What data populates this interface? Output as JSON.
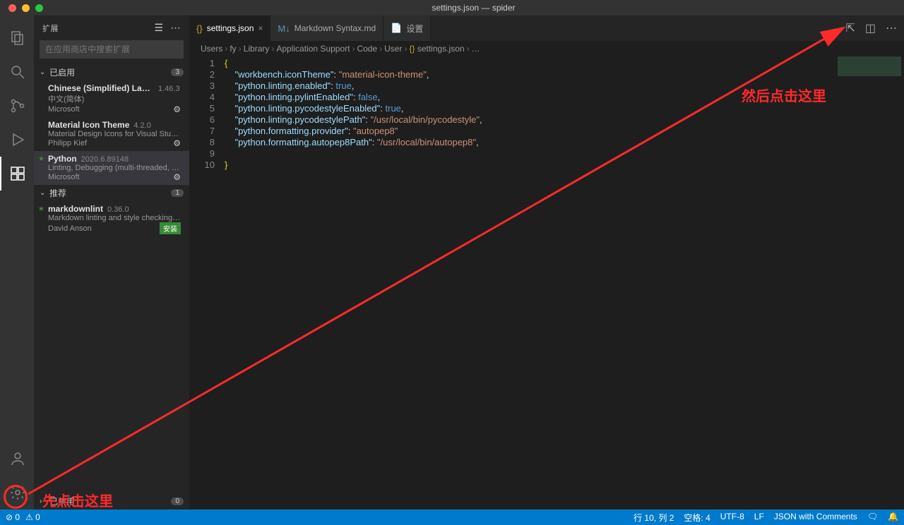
{
  "window": {
    "title": "settings.json — spider"
  },
  "sidebar": {
    "title": "扩展",
    "search_placeholder": "在应用商店中搜索扩展",
    "sections": {
      "installed": {
        "label": "已启用",
        "count": "3"
      },
      "recommended": {
        "label": "推荐",
        "count": "1"
      },
      "disabled": {
        "label": "已禁用",
        "count": "0"
      }
    },
    "installed_items": [
      {
        "name": "Chinese (Simplified) Langua…",
        "version": "1.46.3",
        "desc": "中文(简体)",
        "publisher": "Microsoft"
      },
      {
        "name": "Material Icon Theme",
        "version": "4.2.0",
        "desc": "Material Design Icons for Visual Studi…",
        "publisher": "Philipp Kief"
      },
      {
        "name": "Python",
        "version": "2020.6.89148",
        "desc": "Linting, Debugging (multi-threaded, r…",
        "publisher": "Microsoft",
        "highlighted": true,
        "starred": true
      }
    ],
    "recommended_items": [
      {
        "name": "markdownlint",
        "version": "0.36.0",
        "desc": "Markdown linting and style checking …",
        "publisher": "David Anson",
        "install": "安装",
        "starred": true
      }
    ]
  },
  "tabs": [
    {
      "id": "settings",
      "label": "settings.json",
      "active": true,
      "icon": "{}",
      "icon_color": "#c9a026"
    },
    {
      "id": "md",
      "label": "Markdown Syntax.md",
      "active": false,
      "icon": "M↓",
      "icon_color": "#519aba"
    },
    {
      "id": "settings-ui",
      "label": "设置",
      "active": false,
      "icon": "📄",
      "icon_color": "#519aba"
    }
  ],
  "breadcrumb": [
    "Users",
    "fy",
    "Library",
    "Application Support",
    "Code",
    "User",
    "settings.json",
    "…"
  ],
  "code": {
    "lines": [
      {
        "n": "1",
        "t": "{",
        "cls": "brace"
      },
      {
        "n": "2",
        "t": [
          "    ",
          [
            "\"workbench.iconTheme\"",
            "key"
          ],
          [
            ": ",
            "pun"
          ],
          [
            "\"material-icon-theme\"",
            "str"
          ],
          [
            ",",
            "pun"
          ]
        ]
      },
      {
        "n": "3",
        "t": [
          "    ",
          [
            "\"python.linting.enabled\"",
            "key"
          ],
          [
            ": ",
            "pun"
          ],
          [
            "true",
            "bool"
          ],
          [
            ",",
            "pun"
          ]
        ]
      },
      {
        "n": "4",
        "t": [
          "    ",
          [
            "\"python.linting.pylintEnabled\"",
            "key"
          ],
          [
            ": ",
            "pun"
          ],
          [
            "false",
            "bool"
          ],
          [
            ",",
            "pun"
          ]
        ]
      },
      {
        "n": "5",
        "t": [
          "    ",
          [
            "\"python.linting.pycodestyleEnabled\"",
            "key"
          ],
          [
            ": ",
            "pun"
          ],
          [
            "true",
            "bool"
          ],
          [
            ",",
            "pun"
          ]
        ]
      },
      {
        "n": "6",
        "t": [
          "    ",
          [
            "\"python.linting.pycodestylePath\"",
            "key"
          ],
          [
            ": ",
            "pun"
          ],
          [
            "\"/usr/local/bin/pycodestyle\"",
            "str"
          ],
          [
            ",",
            "pun"
          ]
        ]
      },
      {
        "n": "7",
        "t": [
          "    ",
          [
            "\"python.formatting.provider\"",
            "key"
          ],
          [
            ": ",
            "pun"
          ],
          [
            "\"autopep8\"",
            "str"
          ]
        ]
      },
      {
        "n": "8",
        "t": [
          "    ",
          [
            "\"python.formatting.autopep8Path\"",
            "key"
          ],
          [
            ": ",
            "pun"
          ],
          [
            "\"/usr/local/bin/autopep8\"",
            "str"
          ],
          [
            ",",
            "pun"
          ]
        ]
      },
      {
        "n": "9",
        "t": "",
        "cls": ""
      },
      {
        "n": "10",
        "t": "}",
        "cls": "brace"
      }
    ]
  },
  "statusbar": {
    "left": [
      "⊘ 0",
      "⚠ 0"
    ],
    "right": [
      "行 10, 列 2",
      "空格: 4",
      "UTF-8",
      "LF",
      "JSON with Comments",
      "🗨",
      "🔔"
    ]
  },
  "annotations": {
    "top": "然后点击这里",
    "bottom": "先点击这里"
  }
}
